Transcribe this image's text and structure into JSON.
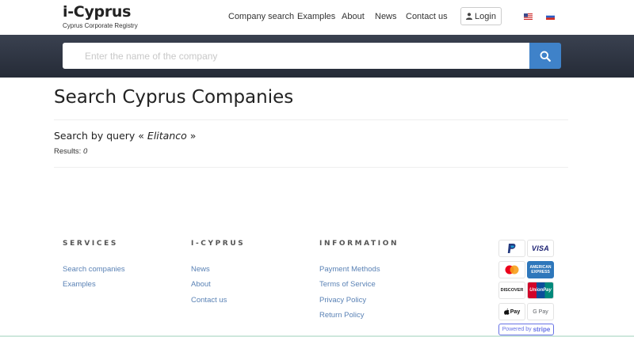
{
  "brand": {
    "title": "i-Cyprus",
    "subtitle": "Cyprus Corporate Registry"
  },
  "nav": {
    "items": [
      {
        "label": "Company search"
      },
      {
        "label": "Examples"
      },
      {
        "label": "About"
      },
      {
        "label": "News"
      },
      {
        "label": "Contact us"
      }
    ],
    "login_label": "Login",
    "languages": [
      "en-flag-icon",
      "ru-flag-icon"
    ]
  },
  "search": {
    "value": "",
    "placeholder": "Enter the name of the company"
  },
  "main": {
    "title": "Search Cyprus Companies",
    "query_prefix": "Search by query «",
    "query_value": "Elitanco",
    "query_suffix": "»",
    "results_label": "Results:",
    "results_count": "0"
  },
  "footer": {
    "services": {
      "heading": "SERVICES",
      "links": [
        "Search companies",
        "Examples"
      ]
    },
    "icyprus": {
      "heading": "I-CYPRUS",
      "links": [
        "News",
        "About",
        "Contact us"
      ]
    },
    "information": {
      "heading": "INFORMATION",
      "links": [
        "Payment Methods",
        "Terms of Service",
        "Privacy Policy",
        "Return Policy"
      ]
    },
    "payments": {
      "visa": "VISA",
      "amex": "AMERICAN EXPRESS",
      "discover": "DISCOVER",
      "unionpay": "UnionPay",
      "applepay": "Pay",
      "gpay": "G Pay",
      "stripe_prefix": "Powered by",
      "stripe_brand": "stripe"
    }
  },
  "colors": {
    "accent": "#3f82c9",
    "band": "#2c3240",
    "link": "#5a82b5"
  }
}
